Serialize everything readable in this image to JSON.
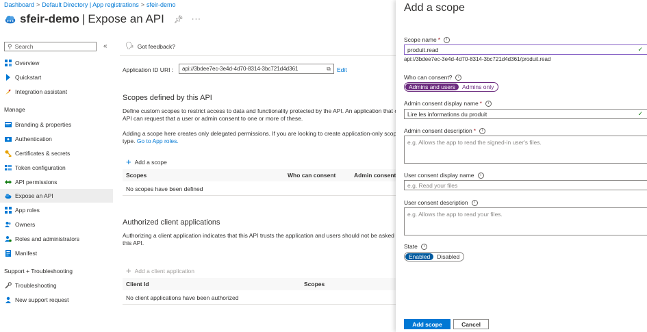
{
  "breadcrumb": [
    "Dashboard",
    "Default Directory | App registrations",
    "sfeir-demo"
  ],
  "breadcrumb_sep": ">",
  "title": {
    "app": "sfeir-demo",
    "separator": "|",
    "page": "Expose an API",
    "pin_icon": "pin-icon",
    "more": "···"
  },
  "sidebar": {
    "search_placeholder": "Search",
    "collapse": "«",
    "items_top": [
      {
        "label": "Overview",
        "icon": "overview-icon"
      },
      {
        "label": "Quickstart",
        "icon": "quickstart-icon"
      },
      {
        "label": "Integration assistant",
        "icon": "rocket-icon"
      }
    ],
    "manage_header": "Manage",
    "manage_items": [
      {
        "label": "Branding & properties",
        "icon": "branding-icon"
      },
      {
        "label": "Authentication",
        "icon": "authentication-icon"
      },
      {
        "label": "Certificates & secrets",
        "icon": "key-icon"
      },
      {
        "label": "Token configuration",
        "icon": "token-icon"
      },
      {
        "label": "API permissions",
        "icon": "api-permissions-icon"
      },
      {
        "label": "Expose an API",
        "icon": "cloud-icon",
        "active": true
      },
      {
        "label": "App roles",
        "icon": "app-roles-icon"
      },
      {
        "label": "Owners",
        "icon": "owners-icon"
      },
      {
        "label": "Roles and administrators",
        "icon": "roles-icon"
      },
      {
        "label": "Manifest",
        "icon": "manifest-icon"
      }
    ],
    "support_header": "Support + Troubleshooting",
    "support_items": [
      {
        "label": "Troubleshooting",
        "icon": "wrench-icon"
      },
      {
        "label": "New support request",
        "icon": "support-icon"
      }
    ]
  },
  "main": {
    "feedback": "Got feedback?",
    "uri_label": "Application ID URI :",
    "uri_value": "api://3bdee7ec-3e4d-4d70-8314-3bc721d4d361",
    "uri_edit": "Edit",
    "scopes_title": "Scopes defined by this API",
    "scopes_desc_1": "Define custom scopes to restrict access to data and functionality protected by the API. An application that c",
    "scopes_desc_2": "API can request that a user or admin consent to one or more of these.",
    "scopes_desc_3": "Adding a scope here creates only delegated permissions. If you are looking to create application-only scop",
    "scopes_desc_4_prefix": "type.",
    "scopes_desc_4_link": "Go to App roles.",
    "add_scope": "Add a scope",
    "scopes_headers": [
      "Scopes",
      "Who can consent",
      "Admin consent"
    ],
    "scopes_empty": "No scopes have been defined",
    "clients_title": "Authorized client applications",
    "clients_desc_1": "Authorizing a client application indicates that this API trusts the application and users should not be asked",
    "clients_desc_2": "this API.",
    "add_client": "Add a client application",
    "clients_headers": [
      "Client Id",
      "Scopes"
    ],
    "clients_empty": "No client applications have been authorized"
  },
  "panel": {
    "title": "Add a scope",
    "scope_name_label": "Scope name",
    "scope_name_value": "produit.read",
    "scope_hint": "api://3bdee7ec-3e4d-4d70-8314-3bc721d4d361/produit.read",
    "consent_label": "Who can consent?",
    "consent_options": [
      "Admins and users",
      "Admins only"
    ],
    "consent_selected": "Admins and users",
    "admin_display_label": "Admin consent display name",
    "admin_display_value": "Lire les informations du produit",
    "admin_desc_label": "Admin consent description",
    "admin_desc_placeholder": "e.g. Allows the app to read the signed-in user's files.",
    "user_display_label": "User consent display name",
    "user_display_placeholder": "e.g. Read your files",
    "user_desc_label": "User consent description",
    "user_desc_placeholder": "e.g. Allows the app to read your files.",
    "state_label": "State",
    "state_options": [
      "Enabled",
      "Disabled"
    ],
    "state_selected": "Enabled",
    "required_mark": "*",
    "add_button": "Add scope",
    "cancel_button": "Cancel"
  },
  "colors": {
    "accent": "#0078d4",
    "consent_selected": "#6b2a7e",
    "valid_check": "#107c10"
  }
}
